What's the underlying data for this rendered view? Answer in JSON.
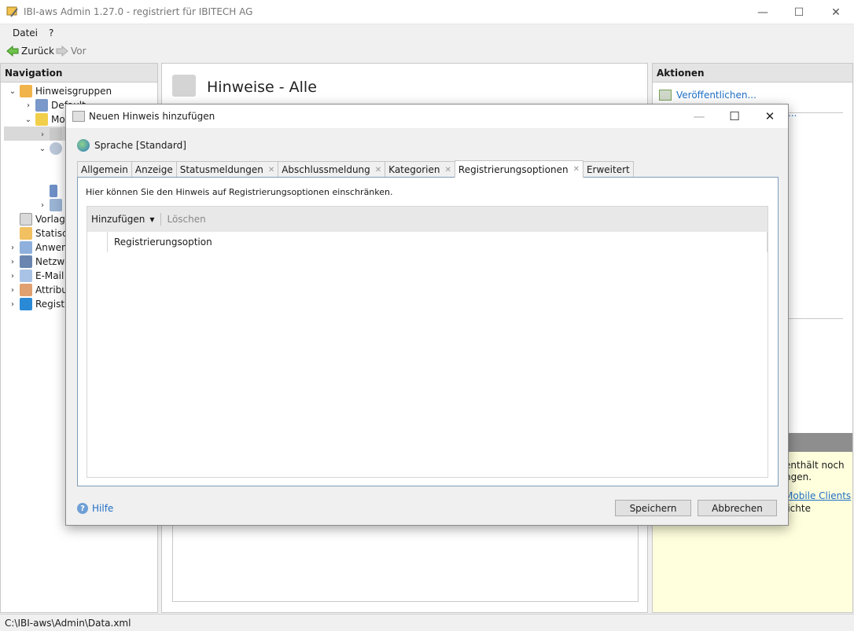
{
  "window": {
    "title": "IBI-aws Admin 1.27.0 - registriert für IBITECH AG",
    "minimize": "—",
    "maximize": "☐",
    "close": "✕"
  },
  "menu": {
    "items": [
      "Datei",
      "?"
    ]
  },
  "toolbar": {
    "back": "Zurück",
    "forward": "Vor"
  },
  "navigation": {
    "header": "Navigation",
    "items": [
      {
        "label": "Hinweisgruppen"
      },
      {
        "label": "Default"
      },
      {
        "label": "Mo"
      },
      {
        "label": ""
      },
      {
        "label": ""
      },
      {
        "label": ""
      },
      {
        "label": ""
      },
      {
        "label": "Vorlage"
      },
      {
        "label": "Statiscl"
      },
      {
        "label": "Anwen"
      },
      {
        "label": "Netzwe"
      },
      {
        "label": "E-Mail"
      },
      {
        "label": "Attribu"
      },
      {
        "label": "Registr"
      }
    ]
  },
  "center": {
    "title": "Hinweise - Alle"
  },
  "actions": {
    "header": "Aktionen",
    "publish": "Veröffentlichen...",
    "link_fragment": "...",
    "info_lines": [
      "enthält noch",
      "ngen.",
      "Mobile Clients",
      "lichte"
    ]
  },
  "status": {
    "path": "C:\\IBI-aws\\Admin\\Data.xml"
  },
  "dialog": {
    "title": "Neuen Hinweis hinzufügen",
    "language": "Sprache [Standard]",
    "tabs": [
      {
        "label": "Allgemein",
        "closable": false
      },
      {
        "label": "Anzeige",
        "closable": false
      },
      {
        "label": "Statusmeldungen",
        "closable": true
      },
      {
        "label": "Abschlussmeldung",
        "closable": true
      },
      {
        "label": "Kategorien",
        "closable": true
      },
      {
        "label": "Registrierungsoptionen",
        "closable": true
      },
      {
        "label": "Erweitert",
        "closable": false
      }
    ],
    "description": "Hier können Sie den Hinweis auf Registrierungsoptionen einschränken.",
    "add_label": "Hinzufügen",
    "delete_label": "Löschen",
    "column_header": "Registrierungsoption",
    "help": "Hilfe",
    "save": "Speichern",
    "cancel": "Abbrechen",
    "tab_close_glyph": "✕"
  },
  "colors": {
    "link": "#1f6fc5",
    "info_bg": "#ffffdd",
    "selection": "#d9d9d9"
  }
}
